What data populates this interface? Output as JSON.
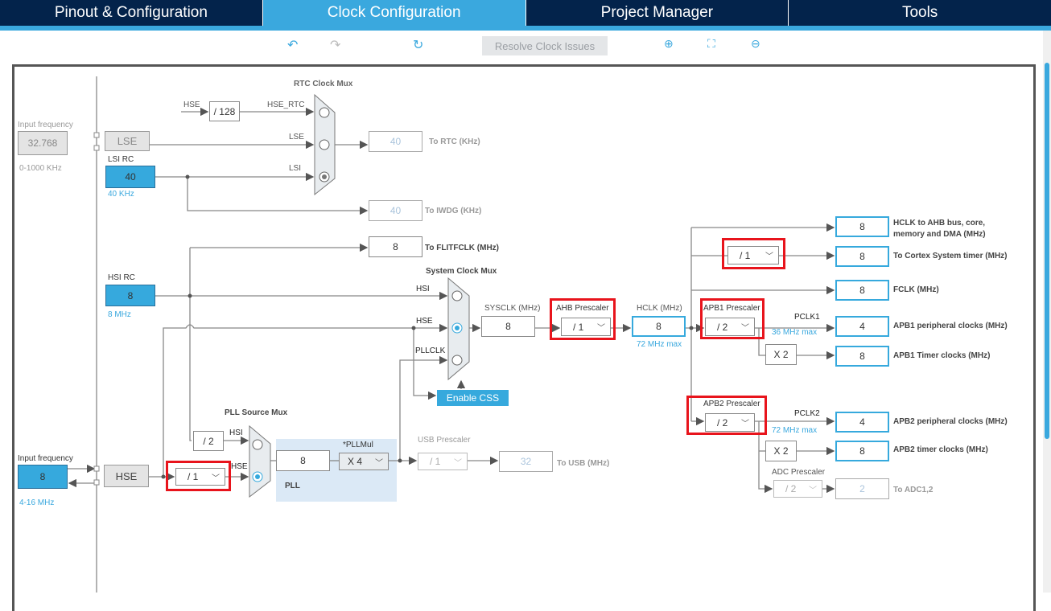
{
  "tabs": [
    {
      "label": "Pinout & Configuration"
    },
    {
      "label": "Clock Configuration",
      "active": true
    },
    {
      "label": "Project Manager"
    },
    {
      "label": "Tools"
    }
  ],
  "toolbar": {
    "undo_icon": "undo-icon",
    "redo_icon": "redo-icon",
    "refresh_icon": "refresh-icon",
    "resolve_label": "Resolve Clock Issues",
    "zoom_in_icon": "zoom-in-icon",
    "fit_icon": "fit-icon",
    "zoom_out_icon": "zoom-out-icon"
  },
  "lse": {
    "input_label": "Input frequency",
    "input_value": "32.768",
    "range": "0-1000 KHz",
    "block": "LSE"
  },
  "lsi": {
    "label": "LSI RC",
    "value": "40",
    "unit": "40 KHz"
  },
  "rtc": {
    "mux_label": "RTC Clock Mux",
    "hse": "HSE",
    "div": "/ 128",
    "hse_rtc": "HSE_RTC",
    "lse": "LSE",
    "lsi": "LSI",
    "out_value": "40",
    "out_label": "To RTC (KHz)",
    "selected": "LSI"
  },
  "iwdg": {
    "value": "40",
    "label": "To IWDG (KHz)"
  },
  "flitf": {
    "value": "8",
    "label": "To FLITFCLK (MHz)"
  },
  "hsi": {
    "label": "HSI RC",
    "value": "8",
    "unit": "8 MHz"
  },
  "sysmux": {
    "label": "System Clock Mux",
    "hsi": "HSI",
    "hse": "HSE",
    "pllclk": "PLLCLK",
    "selected": "HSE",
    "enable_css": "Enable CSS"
  },
  "sysclk": {
    "label": "SYSCLK (MHz)",
    "value": "8"
  },
  "ahb": {
    "label": "AHB Prescaler",
    "value": "/ 1"
  },
  "hclk": {
    "label": "HCLK (MHz)",
    "value": "8",
    "max": "72 MHz max"
  },
  "apb1": {
    "label": "APB1 Prescaler",
    "value": "/ 2",
    "pclk": "PCLK1",
    "max": "36 MHz max",
    "x2": "X 2"
  },
  "apb2": {
    "label": "APB2 Prescaler",
    "value": "/ 2",
    "pclk": "PCLK2",
    "max": "72 MHz max",
    "x2": "X 2"
  },
  "cortex_div": "/ 1",
  "adc": {
    "label": "ADC Prescaler",
    "value": "/ 2",
    "out": "2",
    "out_label": "To ADC1,2"
  },
  "outputs": [
    {
      "value": "8",
      "label1": "HCLK to AHB bus, core,",
      "label2": "memory and DMA (MHz)"
    },
    {
      "value": "8",
      "label1": "To Cortex System timer (MHz)"
    },
    {
      "value": "8",
      "label1": "FCLK (MHz)"
    },
    {
      "value": "4",
      "label1": "APB1 peripheral clocks (MHz)"
    },
    {
      "value": "8",
      "label1": "APB1 Timer clocks (MHz)"
    },
    {
      "value": "4",
      "label1": "APB2 peripheral clocks (MHz)"
    },
    {
      "value": "8",
      "label1": "APB2 timer clocks (MHz)"
    }
  ],
  "pllsrc": {
    "label": "PLL Source Mux",
    "div2": "/ 2",
    "hsi": "HSI",
    "hse": "HSE",
    "selected": "HSE"
  },
  "pll": {
    "label": "PLL",
    "mul_label": "*PLLMul",
    "in_value": "8",
    "mul": "X 4"
  },
  "usb": {
    "label": "USB Prescaler",
    "value": "/ 1",
    "out": "32",
    "out_label": "To USB (MHz)"
  },
  "hse": {
    "input_label": "Input frequency",
    "input_value": "8",
    "range": "4-16 MHz",
    "block": "HSE",
    "div": "/ 1"
  },
  "colors": {
    "tab_bg": "#03234b",
    "accent": "#3aa8de",
    "highlight": "#e8141c"
  }
}
